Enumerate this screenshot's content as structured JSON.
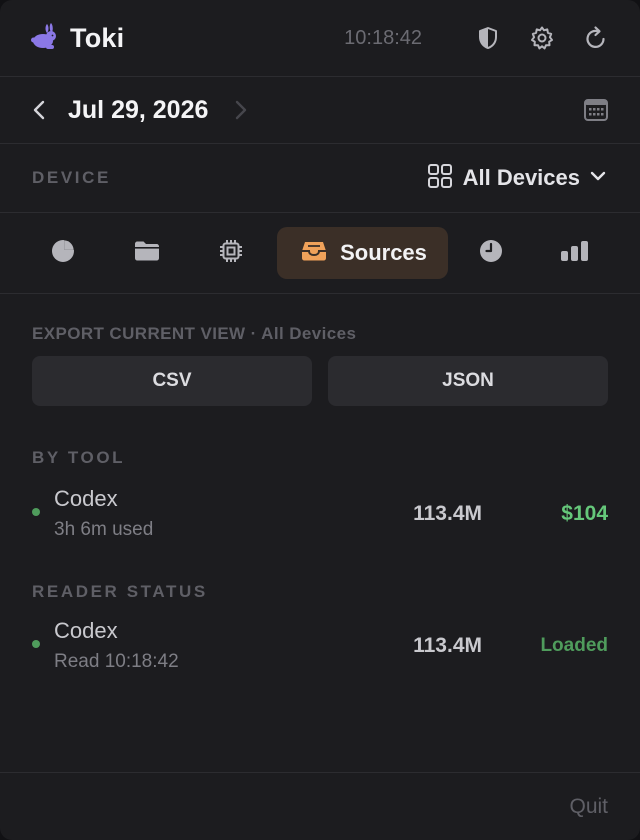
{
  "header": {
    "app_name": "Toki",
    "clock": "10:18:42",
    "icons": [
      "rabbit-icon",
      "shield-icon",
      "gear-icon",
      "refresh-icon"
    ]
  },
  "date_nav": {
    "date": "Jul 29, 2026",
    "icons": [
      "chevron-left-icon",
      "chevron-right-icon",
      "calendar-icon"
    ]
  },
  "device": {
    "label": "DEVICE",
    "selected": "All Devices",
    "icons": [
      "grid-icon",
      "chevron-down-icon"
    ]
  },
  "tabs": {
    "items": [
      {
        "icon": "pie-chart-icon",
        "label": ""
      },
      {
        "icon": "folder-icon",
        "label": ""
      },
      {
        "icon": "chip-icon",
        "label": ""
      },
      {
        "icon": "inbox-tray-icon",
        "label": "Sources",
        "active": true
      },
      {
        "icon": "clock-icon",
        "label": ""
      },
      {
        "icon": "bar-chart-icon",
        "label": ""
      }
    ],
    "active_label": "Sources"
  },
  "export": {
    "label": "EXPORT CURRENT VIEW · All Devices",
    "csv_label": "CSV",
    "json_label": "JSON"
  },
  "by_tool": {
    "label": "BY TOOL",
    "rows": [
      {
        "name": "Codex",
        "sub": "3h 6m used",
        "tokens": "113.4M",
        "cost": "$104"
      }
    ]
  },
  "reader_status": {
    "label": "READER STATUS",
    "rows": [
      {
        "name": "Codex",
        "sub": "Read 10:18:42",
        "tokens": "113.4M",
        "status": "Loaded"
      }
    ]
  },
  "footer": {
    "quit_label": "Quit"
  },
  "colors": {
    "background": "#1c1c1f",
    "accent_purple": "#8b78e6",
    "accent_orange": "#f0a25a",
    "active_tab_bg": "#3b2f27",
    "success_green": "#65c77a",
    "dot_green": "#4f9c5c",
    "muted_text": "#5f5f66"
  }
}
